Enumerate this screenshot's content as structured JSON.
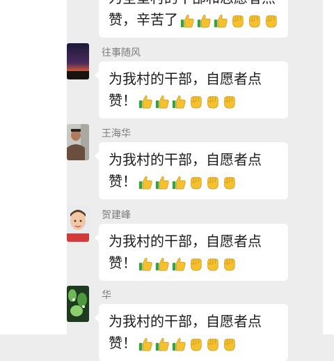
{
  "top_message": {
    "line1": "为全垦村的干部和志愿者点",
    "line2_text": "赞，辛苦了",
    "emojis": [
      "thumbs-up",
      "thumbs-up",
      "thumbs-up",
      "raised-fist",
      "raised-fist",
      "raised-fist"
    ]
  },
  "messages": [
    {
      "sender": "往事随风",
      "line1": "为我村的干部，自愿者点",
      "line2_text": "赞！",
      "emojis": [
        "thumbs-up",
        "thumbs-up",
        "thumbs-up",
        "raised-fist",
        "raised-fist",
        "raised-fist"
      ]
    },
    {
      "sender": "王海华",
      "line1": "为我村的干部，自愿者点",
      "line2_text": "赞！",
      "emojis": [
        "thumbs-up",
        "thumbs-up",
        "thumbs-up",
        "raised-fist",
        "raised-fist",
        "raised-fist"
      ]
    },
    {
      "sender": "贺建峰",
      "line1": "为我村的干部，自愿者点",
      "line2_text": "赞！",
      "emojis": [
        "thumbs-up",
        "thumbs-up",
        "thumbs-up",
        "raised-fist",
        "raised-fist",
        "raised-fist"
      ]
    },
    {
      "sender": "华",
      "line1": "为我村的干部，自愿者点",
      "line2_text": "赞！",
      "emojis": [
        "thumbs-up",
        "thumbs-up",
        "thumbs-up",
        "raised-fist",
        "raised-fist",
        "raised-fist"
      ]
    }
  ],
  "colors": {
    "chat_background": "#ededed",
    "bubble": "#ffffff",
    "sender_name": "#7b7b7b",
    "emoji_yellow": "#f5c12e",
    "emoji_green": "#3aa040"
  }
}
